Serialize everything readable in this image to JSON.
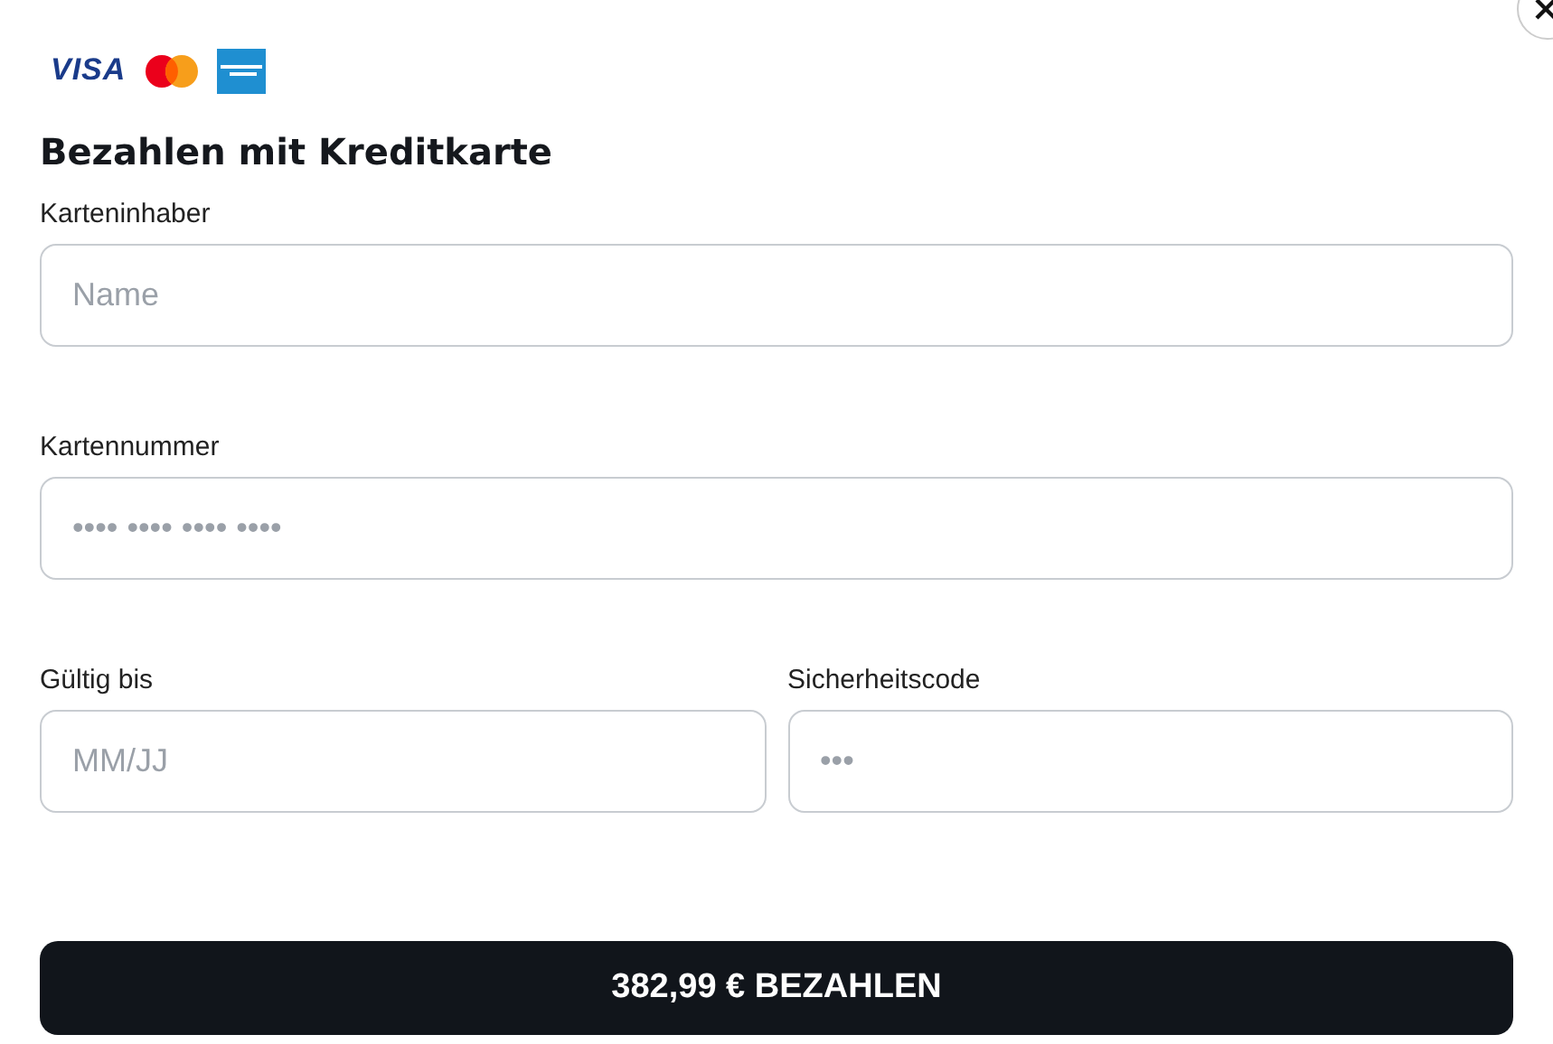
{
  "brands": [
    {
      "kind": "visa",
      "label": "VISA"
    },
    {
      "kind": "mastercard"
    },
    {
      "kind": "amex"
    }
  ],
  "title": "Bezahlen mit Kreditkarte",
  "fields": [
    {
      "label": "Karteninhaber",
      "placeholder": "Name"
    },
    {
      "label": "Kartennummer",
      "placeholder": "•••• •••• •••• ••••"
    },
    {
      "label": "Gültig bis",
      "placeholder": "MM/JJ"
    },
    {
      "label": "Sicherheitscode",
      "placeholder": "•••"
    }
  ],
  "pay_button": "382,99 € BEZAHLEN"
}
